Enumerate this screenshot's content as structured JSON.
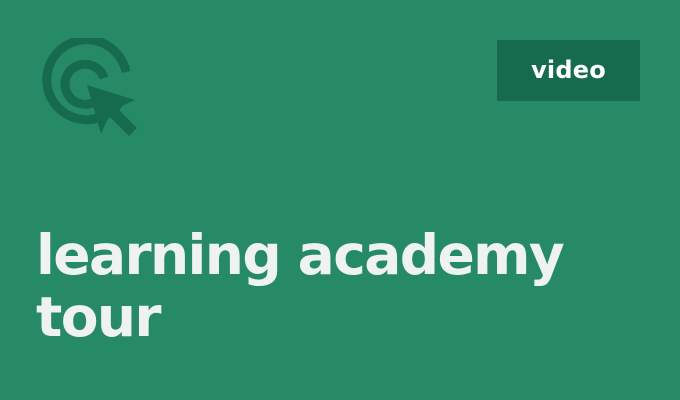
{
  "card": {
    "badge_label": "video",
    "title_lines": [
      "learning academy",
      "tour"
    ],
    "logo_icon": "target-cursor-icon"
  },
  "colors": {
    "background": "#278a67",
    "badge_background": "#166b4e",
    "logo": "#166b4e",
    "title_text": "#eef2f1",
    "badge_text": "#ffffff"
  }
}
